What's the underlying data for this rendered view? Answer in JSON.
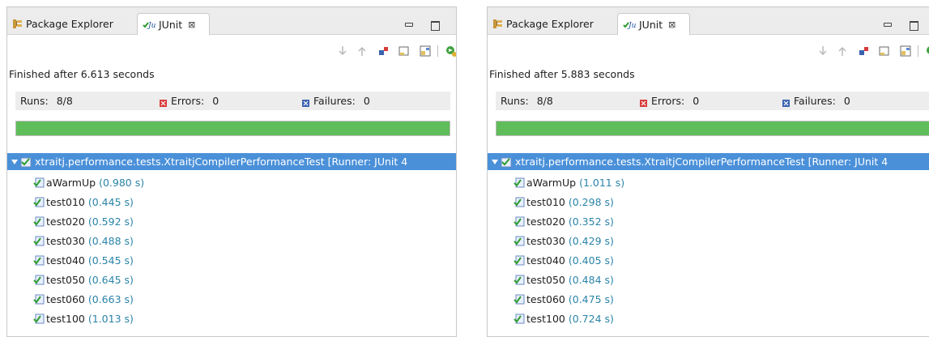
{
  "colors": {
    "progress_green": "#5fbd5a",
    "selection_blue": "#4a90d9",
    "time_text": "#2a84a8",
    "error_red": "#d83a3a",
    "failure_blue": "#3a62b0"
  },
  "panels": [
    {
      "tabs": {
        "package_explorer": "Package Explorer",
        "junit": "JUnit",
        "close_glyph": "⊠"
      },
      "finished": "Finished after 6.613 seconds",
      "stats": {
        "runs_label": "Runs:",
        "runs_value": "8/8",
        "errors_label": "Errors:",
        "errors_value": "0",
        "failures_label": "Failures:",
        "failures_value": "0"
      },
      "progress": 1.0,
      "root": {
        "label": "xtraitj.performance.tests.XtraitjCompilerPerformanceTest [Runner: JUnit 4"
      },
      "tests": [
        {
          "name": "aWarmUp",
          "time": "(0.980 s)"
        },
        {
          "name": "test010",
          "time": "(0.445 s)"
        },
        {
          "name": "test020",
          "time": "(0.592 s)"
        },
        {
          "name": "test030",
          "time": "(0.488 s)"
        },
        {
          "name": "test040",
          "time": "(0.545 s)"
        },
        {
          "name": "test050",
          "time": "(0.645 s)"
        },
        {
          "name": "test060",
          "time": "(0.663 s)"
        },
        {
          "name": "test100",
          "time": "(1.013 s)"
        }
      ]
    },
    {
      "tabs": {
        "package_explorer": "Package Explorer",
        "junit": "JUnit",
        "close_glyph": "⊠"
      },
      "finished": "Finished after 5.883 seconds",
      "stats": {
        "runs_label": "Runs:",
        "runs_value": "8/8",
        "errors_label": "Errors:",
        "errors_value": "0",
        "failures_label": "Failures:",
        "failures_value": "0"
      },
      "progress": 1.0,
      "root": {
        "label": "xtraitj.performance.tests.XtraitjCompilerPerformanceTest [Runner: JUnit 4"
      },
      "tests": [
        {
          "name": "aWarmUp",
          "time": "(1.011 s)"
        },
        {
          "name": "test010",
          "time": "(0.298 s)"
        },
        {
          "name": "test020",
          "time": "(0.352 s)"
        },
        {
          "name": "test030",
          "time": "(0.429 s)"
        },
        {
          "name": "test040",
          "time": "(0.405 s)"
        },
        {
          "name": "test050",
          "time": "(0.484 s)"
        },
        {
          "name": "test060",
          "time": "(0.475 s)"
        },
        {
          "name": "test100",
          "time": "(0.724 s)"
        }
      ]
    }
  ]
}
